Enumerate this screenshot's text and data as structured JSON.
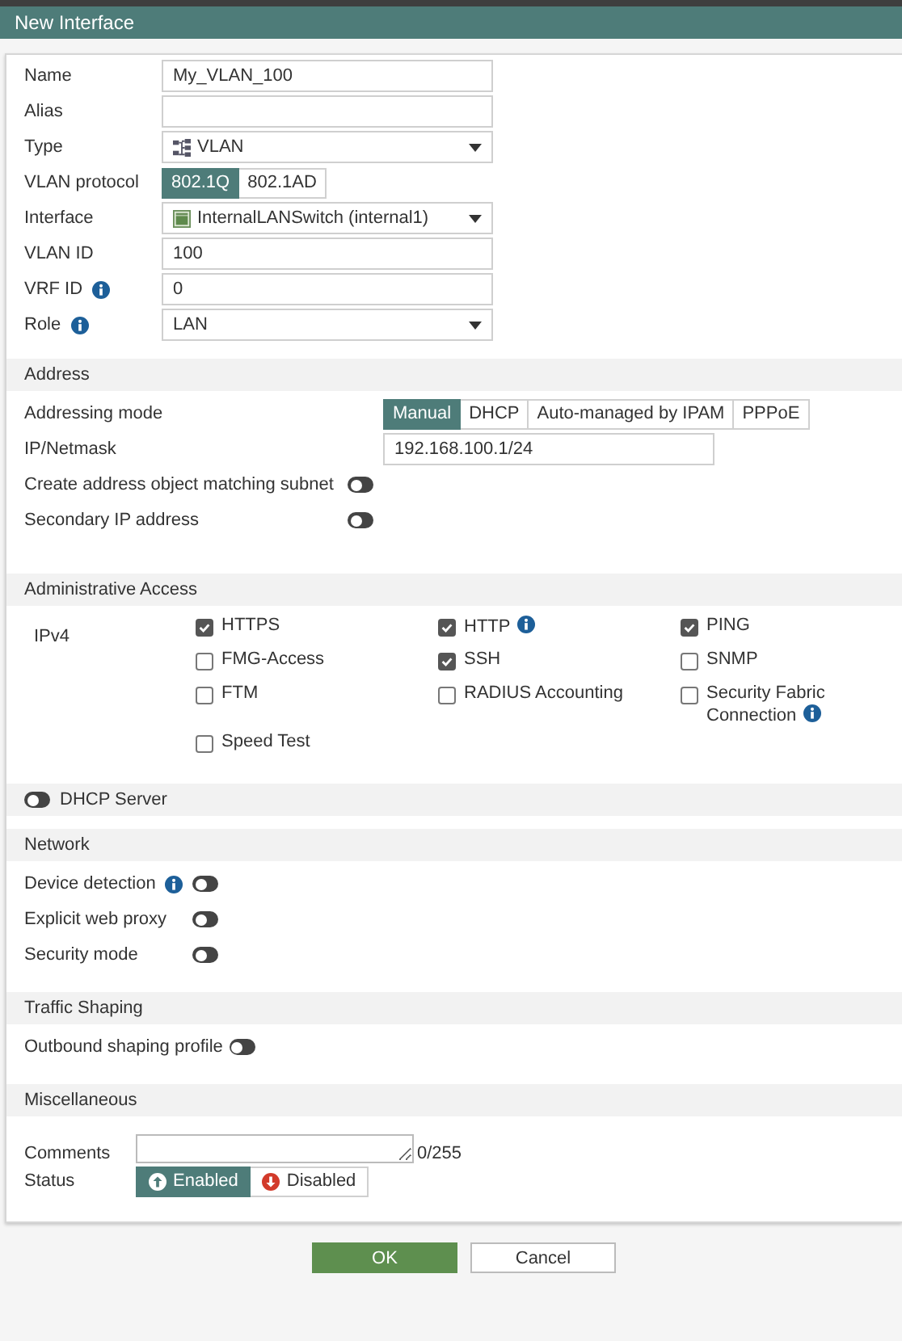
{
  "window": {
    "title": "New Interface"
  },
  "general": [
    {
      "kind": "text",
      "label": "Name",
      "value": "My_VLAN_100"
    },
    {
      "kind": "text",
      "label": "Alias"
    },
    {
      "kind": "select",
      "label": "Type",
      "value": "VLAN"
    },
    {
      "kind": "segmented",
      "label": "VLAN protocol",
      "options": [
        {
          "label": "802.1Q",
          "selected": true
        },
        {
          "label": "802.1AD",
          "selected": false
        }
      ]
    },
    {
      "kind": "select",
      "label": "Interface",
      "value": "InternalLANSwitch (internal1)"
    },
    {
      "kind": "text",
      "label": "VLAN ID",
      "value": "100"
    },
    {
      "kind": "text",
      "label": "VRF ID",
      "value": "0",
      "info": true
    },
    {
      "kind": "select",
      "label": "Role",
      "value": "LAN",
      "info": true
    }
  ],
  "address": {
    "title": "Address",
    "rows": [
      {
        "kind": "segmented",
        "label": "Addressing mode",
        "options": [
          {
            "label": "Manual",
            "selected": true
          },
          {
            "label": "DHCP",
            "selected": false
          },
          {
            "label": "Auto-managed by IPAM",
            "selected": false
          },
          {
            "label": "PPPoE",
            "selected": false
          }
        ]
      },
      {
        "kind": "text",
        "label": "IP/Netmask",
        "value": "192.168.100.1/24"
      },
      {
        "kind": "toggle",
        "label": "Create address object matching subnet",
        "on": false
      },
      {
        "kind": "toggle",
        "label": "Secondary IP address",
        "on": false
      }
    ]
  },
  "admin_access": {
    "title": "Administrative Access",
    "protocol_label": "IPv4",
    "options": [
      {
        "label": "HTTPS",
        "checked": true
      },
      {
        "label": "HTTP",
        "checked": true,
        "info": true
      },
      {
        "label": "PING",
        "checked": true
      },
      {
        "label": "FMG-Access",
        "checked": false
      },
      {
        "label": "SSH",
        "checked": true
      },
      {
        "label": "SNMP",
        "checked": false
      },
      {
        "label": "FTM",
        "checked": false
      },
      {
        "label": "RADIUS Accounting",
        "checked": false
      },
      {
        "label": "Security Fabric Connection",
        "checked": false,
        "info": true
      },
      {
        "label": "Speed Test",
        "checked": false
      }
    ]
  },
  "dhcp_server": {
    "label": "DHCP Server",
    "on": false
  },
  "network": {
    "title": "Network",
    "rows": [
      {
        "label": "Device detection",
        "info": true,
        "on": false
      },
      {
        "label": "Explicit web proxy",
        "on": false
      },
      {
        "label": "Security mode",
        "on": false
      }
    ]
  },
  "traffic_shaping": {
    "title": "Traffic Shaping",
    "rows": [
      {
        "label": "Outbound shaping profile",
        "on": false
      }
    ]
  },
  "miscellaneous": {
    "title": "Miscellaneous",
    "comments": {
      "label": "Comments",
      "counter": "0/255"
    },
    "status": {
      "label": "Status",
      "options": [
        {
          "label": "Enabled",
          "kind": "up",
          "selected": true
        },
        {
          "label": "Disabled",
          "kind": "down",
          "selected": false
        }
      ]
    }
  },
  "buttons": [
    {
      "label": "OK",
      "kind": "primary"
    },
    {
      "label": "Cancel",
      "kind": "secondary"
    }
  ]
}
